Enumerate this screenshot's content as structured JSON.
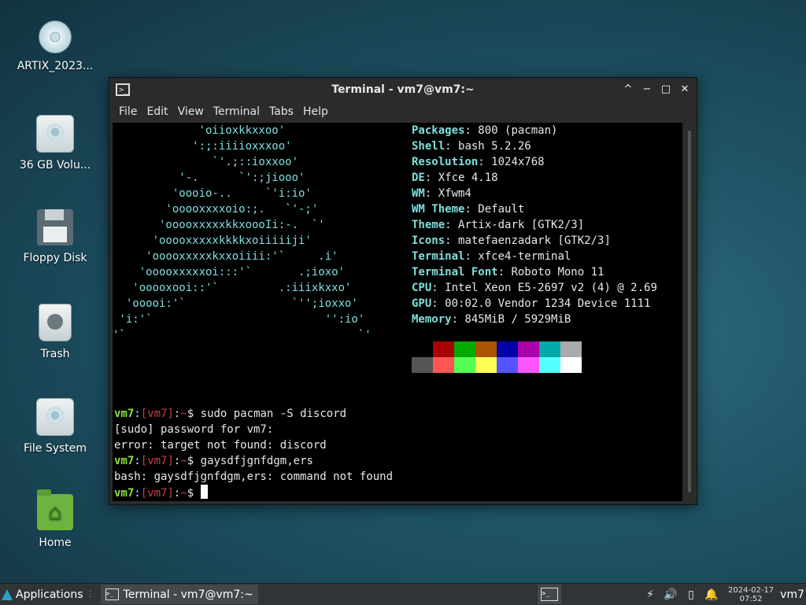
{
  "desktop": {
    "icons": [
      {
        "label": "ARTIX_2023..."
      },
      {
        "label": "36 GB Volu..."
      },
      {
        "label": "Floppy Disk"
      },
      {
        "label": "Trash"
      },
      {
        "label": "File System"
      },
      {
        "label": "Home"
      }
    ]
  },
  "window": {
    "title": "Terminal - vm7@vm7:~",
    "menu": [
      "File",
      "Edit",
      "View",
      "Terminal",
      "Tabs",
      "Help"
    ],
    "controls": {
      "shade": "^",
      "minimize": "−",
      "maximize": "□",
      "close": "✕"
    }
  },
  "terminal": {
    "ascii": "             'oiioxkkxxoo'\n            ':;:iiiioxxxoo'\n               `'.;::ioxxoo'\n          '-.      `':;jiooo'\n         'oooio-..     `'i:io'\n        'ooooxxxxoio:;.   `'-;'\n       'ooooxxxxxkkxoooIi:-.  `'\n      'ooooxxxxxkkkkxoiiiiiji'\n     'ooooxxxxxkxxoiiii:'`     .i'\n    'ooooxxxxxoi:::'`       .;ioxo'\n   'ooooxooi::'`         .:iiixkxxo'\n  'ooooi:'`                `'';ioxxo'\n 'i:'`                          '':io'\n'`                                   `'",
    "info": [
      {
        "key": "Packages",
        "value": "800 (pacman)"
      },
      {
        "key": "Shell",
        "value": "bash 5.2.26"
      },
      {
        "key": "Resolution",
        "value": "1024x768"
      },
      {
        "key": "DE",
        "value": "Xfce 4.18"
      },
      {
        "key": "WM",
        "value": "Xfwm4"
      },
      {
        "key": "WM Theme",
        "value": "Default"
      },
      {
        "key": "Theme",
        "value": "Artix-dark [GTK2/3]"
      },
      {
        "key": "Icons",
        "value": "matefaenzadark [GTK2/3]"
      },
      {
        "key": "Terminal",
        "value": "xfce4-terminal"
      },
      {
        "key": "Terminal Font",
        "value": "Roboto Mono 11"
      },
      {
        "key": "CPU",
        "value": "Intel Xeon E5-2697 v2 (4) @ 2.69"
      },
      {
        "key": "GPU",
        "value": "00:02.0 Vendor 1234 Device 1111"
      },
      {
        "key": "Memory",
        "value": "845MiB / 5929MiB"
      }
    ],
    "palette_dark": [
      "#000000",
      "#aa0000",
      "#00aa00",
      "#aa5500",
      "#0000aa",
      "#aa00aa",
      "#00aaaa",
      "#aaaaaa"
    ],
    "palette_bright": [
      "#555555",
      "#ff5555",
      "#55ff55",
      "#ffff55",
      "#5555ff",
      "#ff55ff",
      "#55ffff",
      "#ffffff"
    ],
    "prompt": {
      "user": "vm7",
      "sep1": ":",
      "lb": "[",
      "host": "vm7",
      "rb": "]",
      "sep2": ":",
      "path": "~",
      "sym": "$"
    },
    "lines": [
      {
        "type": "prompt",
        "cmd": " sudo pacman -S discord"
      },
      {
        "type": "out",
        "text": "[sudo] password for vm7:"
      },
      {
        "type": "out",
        "text": "error: target not found: discord"
      },
      {
        "type": "prompt",
        "cmd": " gaysdfjgnfdgm,ers"
      },
      {
        "type": "out",
        "text": "bash: gaysdfjgnfdgm,ers: command not found"
      },
      {
        "type": "prompt",
        "cmd": " "
      }
    ]
  },
  "taskbar": {
    "applications_label": "Applications",
    "separator": "⋮",
    "task_label": "Terminal - vm7@vm7:~",
    "date": "2024-02-17",
    "time": "07:52",
    "user": "vm7"
  },
  "colors": {
    "accent": "#7ee0dd",
    "prompt_user": "#8ae234",
    "prompt_host": "#cc3d3d"
  }
}
